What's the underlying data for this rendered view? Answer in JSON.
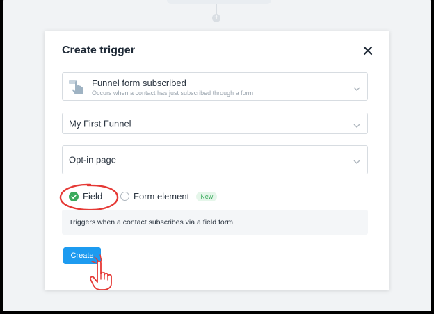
{
  "modal": {
    "title": "Create trigger"
  },
  "trigger_select": {
    "label": "Funnel form subscribed",
    "description": "Occurs when a contact has just subscribed through a form",
    "icon": "hand-pointer-icon"
  },
  "funnel_select": {
    "value": "My First Funnel"
  },
  "page_select": {
    "value": "Opt-in page"
  },
  "source_options": {
    "field_label": "Field",
    "field_selected": true,
    "form_element_label": "Form element",
    "form_element_badge": "New"
  },
  "info": {
    "text": "Triggers when a contact subscribes via a field form"
  },
  "actions": {
    "create_label": "Create"
  },
  "colors": {
    "accent": "#1d9bf0",
    "success": "#3aaa5c",
    "annotation": "#e53935"
  }
}
